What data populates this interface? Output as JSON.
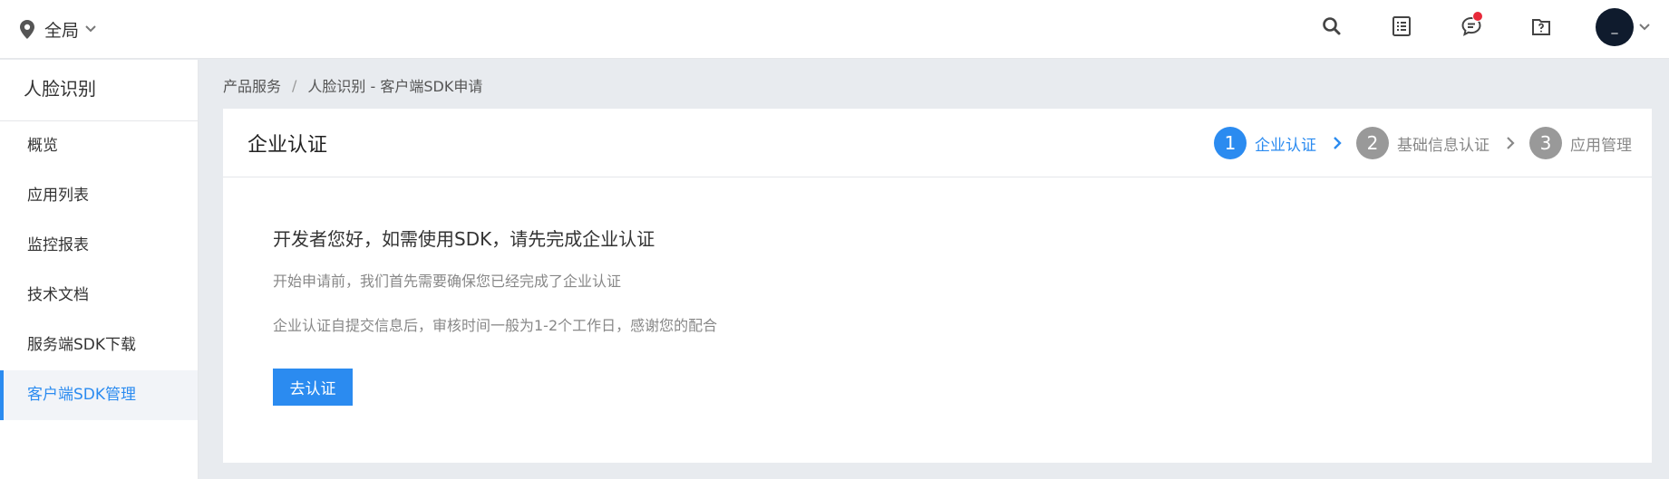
{
  "topbar": {
    "region_label": "全局",
    "region_icon": "map-pin-icon",
    "icons": [
      "search-icon",
      "document-list-icon",
      "chat-icon",
      "help-box-icon"
    ],
    "notification_color": "#e8293a",
    "avatar_text": "_"
  },
  "sidebar": {
    "title": "人脸识别",
    "items": [
      {
        "label": "概览",
        "active": false
      },
      {
        "label": "应用列表",
        "active": false
      },
      {
        "label": "监控报表",
        "active": false
      },
      {
        "label": "技术文档",
        "active": false
      },
      {
        "label": "服务端SDK下载",
        "active": false
      },
      {
        "label": "客户端SDK管理",
        "active": true
      }
    ]
  },
  "breadcrumb": {
    "root": "产品服务",
    "separator": "/",
    "current": "人脸识别 - 客户端SDK申请"
  },
  "card": {
    "title": "企业认证",
    "steps": [
      {
        "num": "1",
        "label": "企业认证",
        "active": true
      },
      {
        "num": "2",
        "label": "基础信息认证",
        "active": false
      },
      {
        "num": "3",
        "label": "应用管理",
        "active": false
      }
    ],
    "heading": "开发者您好，如需使用SDK，请先完成企业认证",
    "line1": "开始申请前，我们首先需要确保您已经完成了企业认证",
    "line2": "企业认证自提交信息后，审核时间一般为1-2个工作日，感谢您的配合",
    "button_label": "去认证"
  },
  "colors": {
    "accent": "#2b8bf0",
    "inactive_step": "#999999",
    "avatar_bg": "#0f1b2d"
  }
}
